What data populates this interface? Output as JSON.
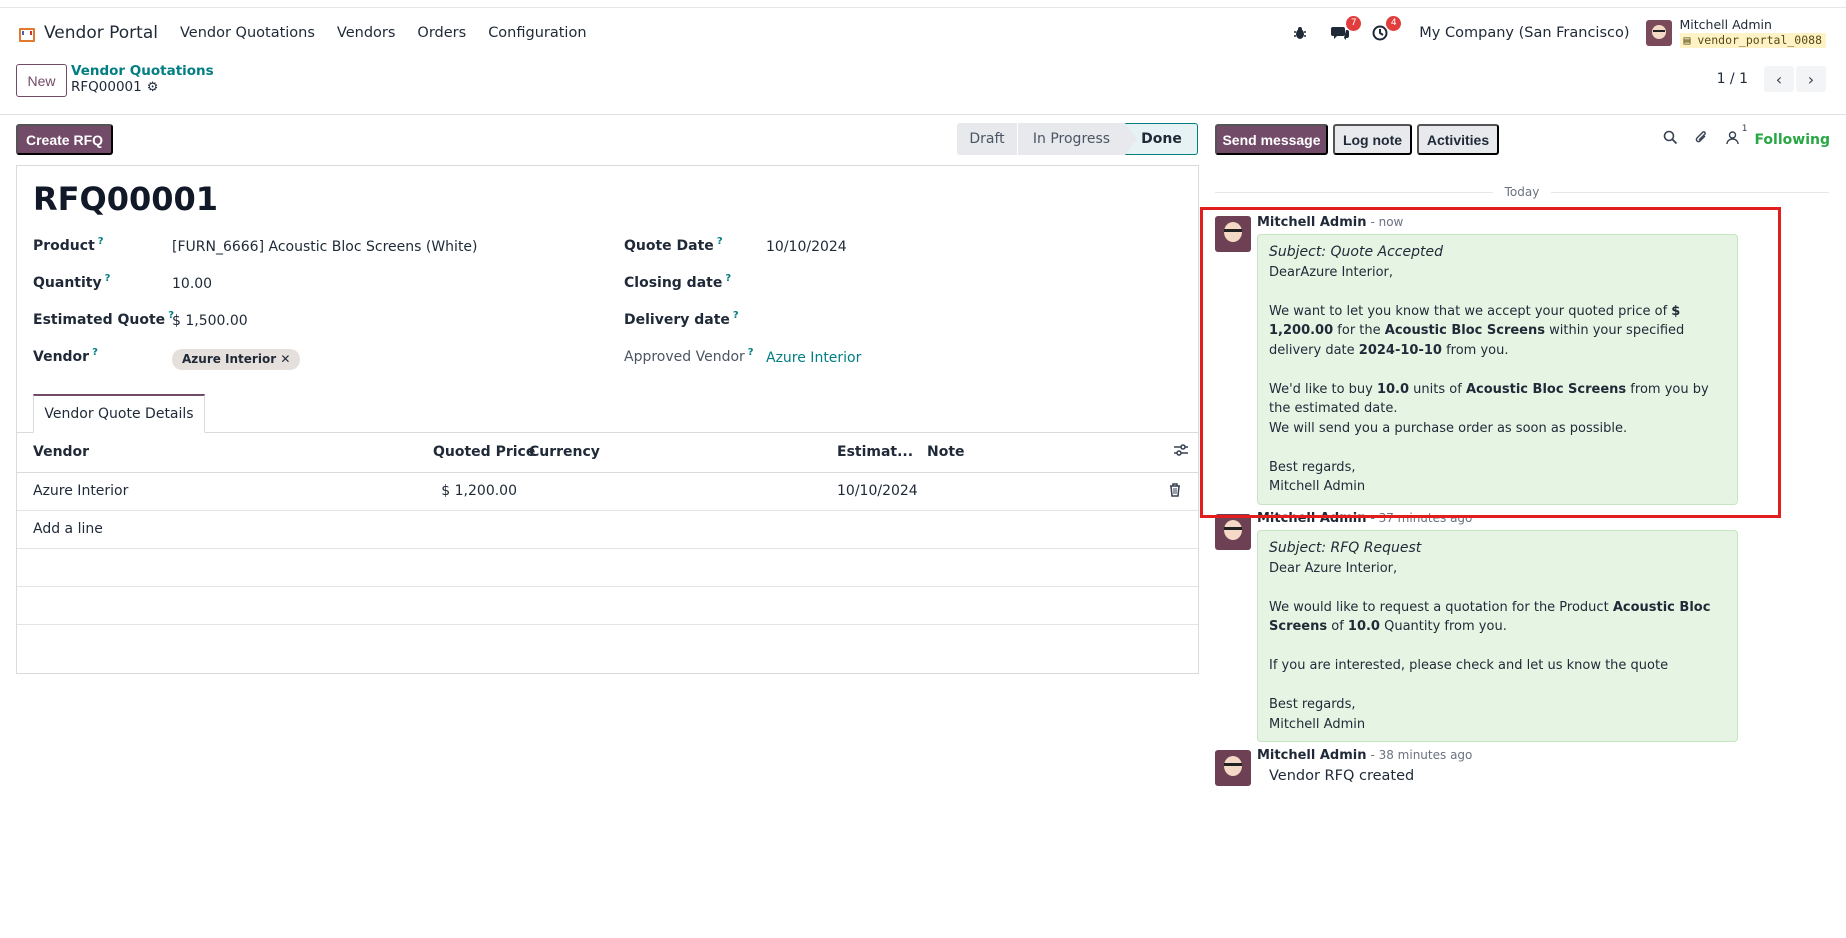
{
  "navbar": {
    "brand": "Vendor Portal",
    "menu": [
      "Vendor Quotations",
      "Vendors",
      "Orders",
      "Configuration"
    ],
    "messages_count": "7",
    "activities_count": "4",
    "company": "My Company (San Francisco)",
    "user_name": "Mitchell Admin",
    "database": "vendor_portal_0088"
  },
  "control": {
    "new_label": "New",
    "breadcrumb_parent": "Vendor Quotations",
    "breadcrumb_current": "RFQ00001",
    "pager": "1 / 1"
  },
  "actions": {
    "create_rfq": "Create RFQ"
  },
  "status": {
    "stages": [
      "Draft",
      "In Progress",
      "Done"
    ],
    "current": "Done"
  },
  "record": {
    "name": "RFQ00001",
    "fields": {
      "product_label": "Product",
      "product_value": "[FURN_6666] Acoustic Bloc Screens (White)",
      "quantity_label": "Quantity",
      "quantity_value": "10.00",
      "estimated_label": "Estimated Quote",
      "estimated_value": "$ 1,500.00",
      "vendor_label": "Vendor",
      "vendor_value": "Azure Interior",
      "quote_date_label": "Quote Date",
      "quote_date_value": "10/10/2024",
      "closing_label": "Closing date",
      "delivery_label": "Delivery date",
      "approved_label": "Approved Vendor",
      "approved_value": "Azure Interior"
    },
    "tab": "Vendor Quote Details",
    "table": {
      "headers": [
        "Vendor",
        "Quoted Price",
        "Currency",
        "Estimat...",
        "Note"
      ],
      "rows": [
        {
          "vendor": "Azure Interior",
          "price": "$ 1,200.00",
          "currency": "",
          "estimate": "10/10/2024",
          "note": ""
        }
      ],
      "add_line": "Add a line"
    }
  },
  "chatter": {
    "send_message": "Send message",
    "log_note": "Log note",
    "activities": "Activities",
    "followers_count": "1",
    "following": "Following",
    "today": "Today",
    "messages": [
      {
        "author": "Mitchell Admin",
        "time": "- now",
        "subject": "Subject: Quote Accepted",
        "greeting": "DearAzure Interior,",
        "p1_a": "We want to let you know that we accept your quoted price of ",
        "p1_price": "$ 1,200.00",
        "p1_b": " for the ",
        "p1_product": "Acoustic Bloc Screens",
        "p1_c": " within your specified delivery date ",
        "p1_date": "2024-10-10",
        "p1_d": " from you.",
        "p2_a": "We'd like to buy ",
        "p2_qty": "10.0",
        "p2_b": " units of ",
        "p2_product": "Acoustic Bloc Screens",
        "p2_c": " from you by the estimated date.",
        "p3": "We will send you a purchase order as soon as possible.",
        "regards": "Best regards,",
        "signature": "Mitchell Admin"
      },
      {
        "author": "Mitchell Admin",
        "time": "- 37 minutes ago",
        "subject": "Subject: RFQ Request",
        "greeting": "Dear Azure Interior,",
        "p1_a": "We would like to request a quotation for the Product ",
        "p1_product": "Acoustic Bloc Screens",
        "p1_b": " of ",
        "p1_qty": "10.0",
        "p1_c": " Quantity from you.",
        "p2": "If you are interested, please check and let us know the quote",
        "regards": "Best regards,",
        "signature": "Mitchell Admin"
      },
      {
        "author": "Mitchell Admin",
        "time": "- 38 minutes ago",
        "body": "Vendor RFQ created"
      }
    ]
  },
  "colors": {
    "primary": "#714b67",
    "link": "#017e84",
    "highlight": "#e11d1d",
    "bubble": "#e6f4e4"
  }
}
